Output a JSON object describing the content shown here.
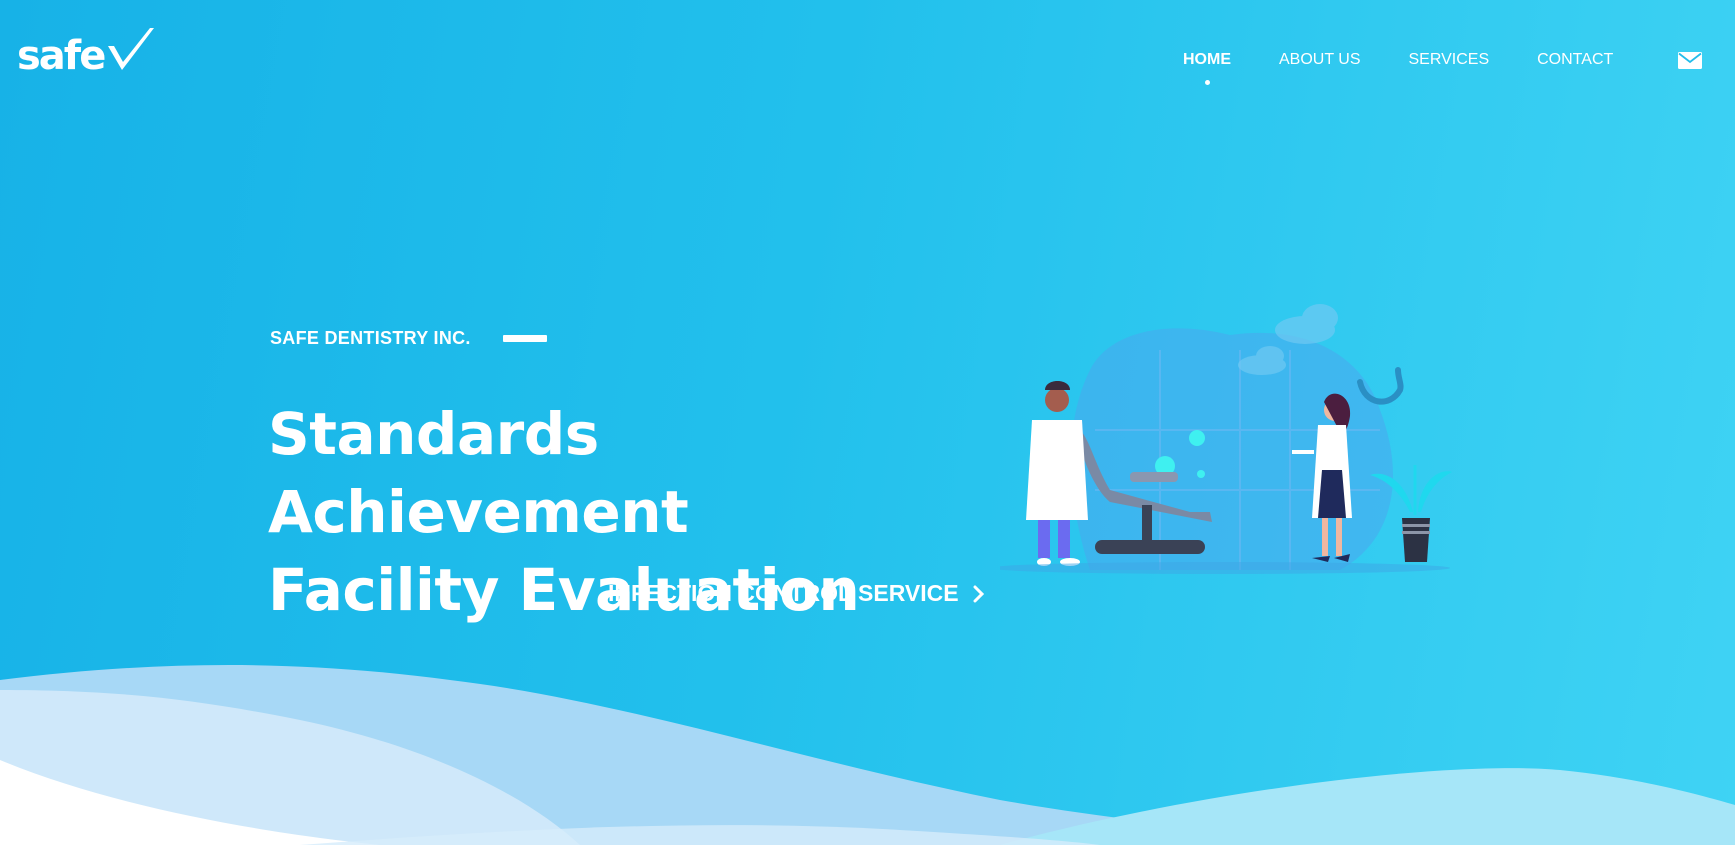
{
  "header": {
    "logo_text": "safe",
    "nav": [
      {
        "label": "HOME",
        "active": true
      },
      {
        "label": "ABOUT US",
        "active": false
      },
      {
        "label": "SERVICES",
        "active": false
      },
      {
        "label": "CONTACT",
        "active": false
      }
    ],
    "mail_icon": "envelope-icon"
  },
  "hero": {
    "eyebrow": "SAFE DENTISTRY INC.",
    "headline_line1": "Standards Achievement",
    "headline_line2": "Facility Evaluation",
    "cta_label": "INFECTION CONTROL SERVICE",
    "cta_icon": "chevron-right-icon"
  },
  "colors": {
    "background_start": "#17b2e7",
    "background_end": "#3fd3f4",
    "text": "#ffffff",
    "wave_light": "#d6ecfb",
    "wave_mid": "#a7d8f6"
  }
}
